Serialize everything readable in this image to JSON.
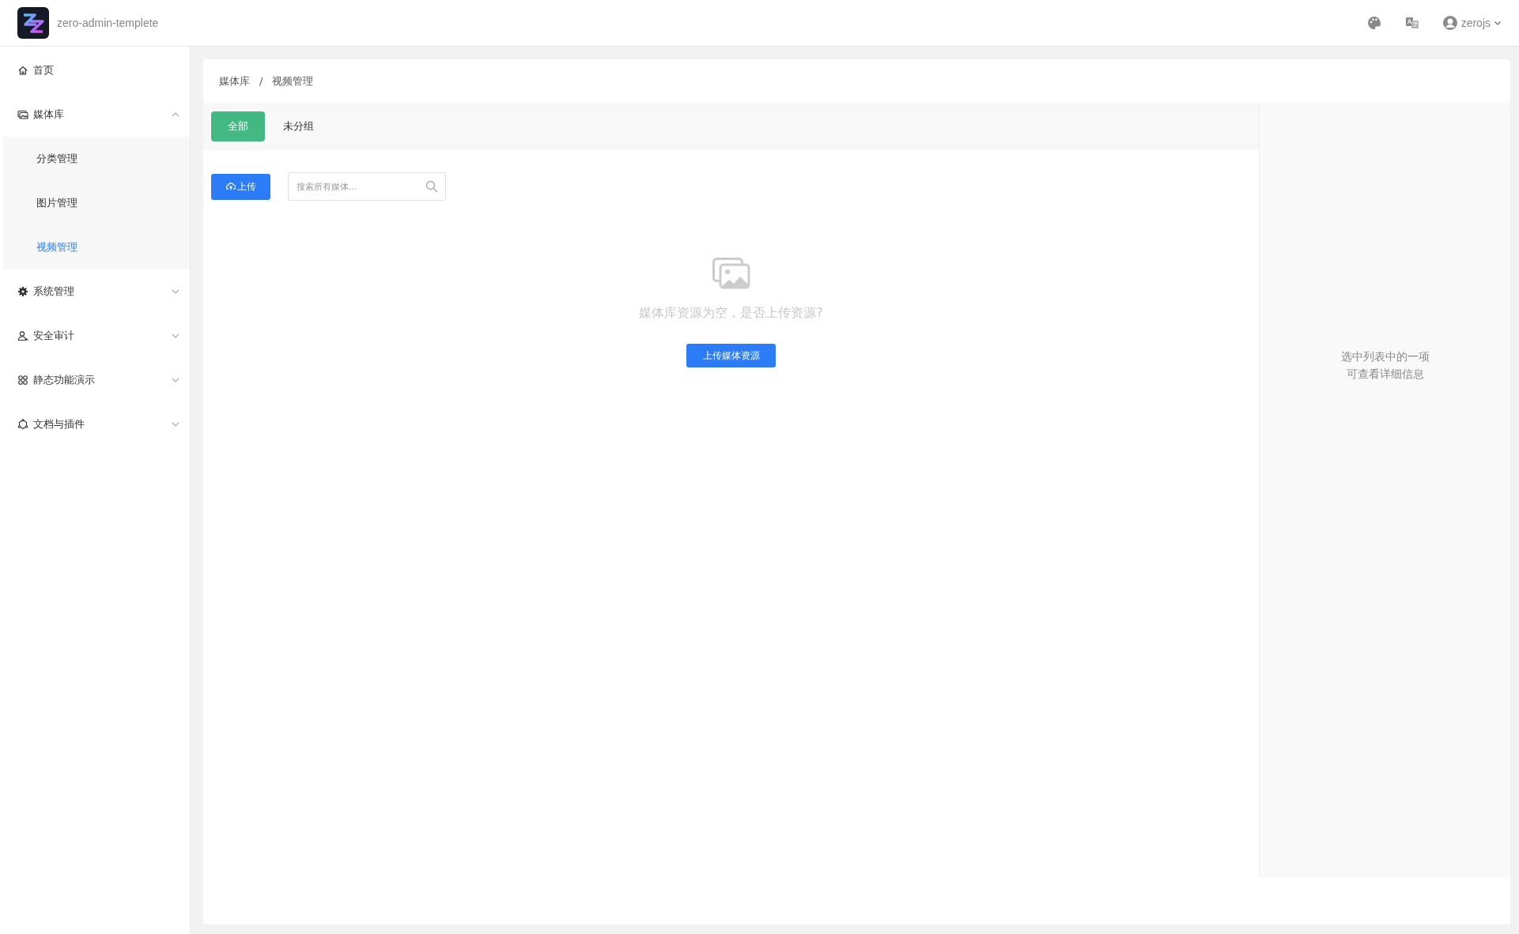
{
  "header": {
    "app_name": "zero-admin-templete",
    "user": {
      "name": "zerojs"
    }
  },
  "sidebar": {
    "items": [
      {
        "label": "首页",
        "selected": false
      },
      {
        "label": "媒体库",
        "expanded": true,
        "children": [
          {
            "label": "分类管理",
            "selected": false
          },
          {
            "label": "图片管理",
            "selected": false
          },
          {
            "label": "视频管理",
            "selected": true
          }
        ]
      },
      {
        "label": "系统管理",
        "expanded": false
      },
      {
        "label": "安全审计",
        "expanded": false
      },
      {
        "label": "静态功能演示",
        "expanded": false
      },
      {
        "label": "文档与插件",
        "expanded": false
      }
    ]
  },
  "breadcrumb": [
    "媒体库",
    "视频管理"
  ],
  "breadcrumb_separator": "/",
  "groups": [
    {
      "label": "全部",
      "selected": true
    },
    {
      "label": "未分组",
      "selected": false
    }
  ],
  "toolbar": {
    "upload_button": "上传",
    "search": {
      "placeholder": "搜索所有媒体..."
    }
  },
  "empty_state": {
    "message": "媒体库资源为空，是否上传资源?",
    "button": "上传媒体资源"
  },
  "detail_panel": {
    "hint_lines": [
      "选中列表中的一项",
      "可查看详细信息"
    ]
  }
}
